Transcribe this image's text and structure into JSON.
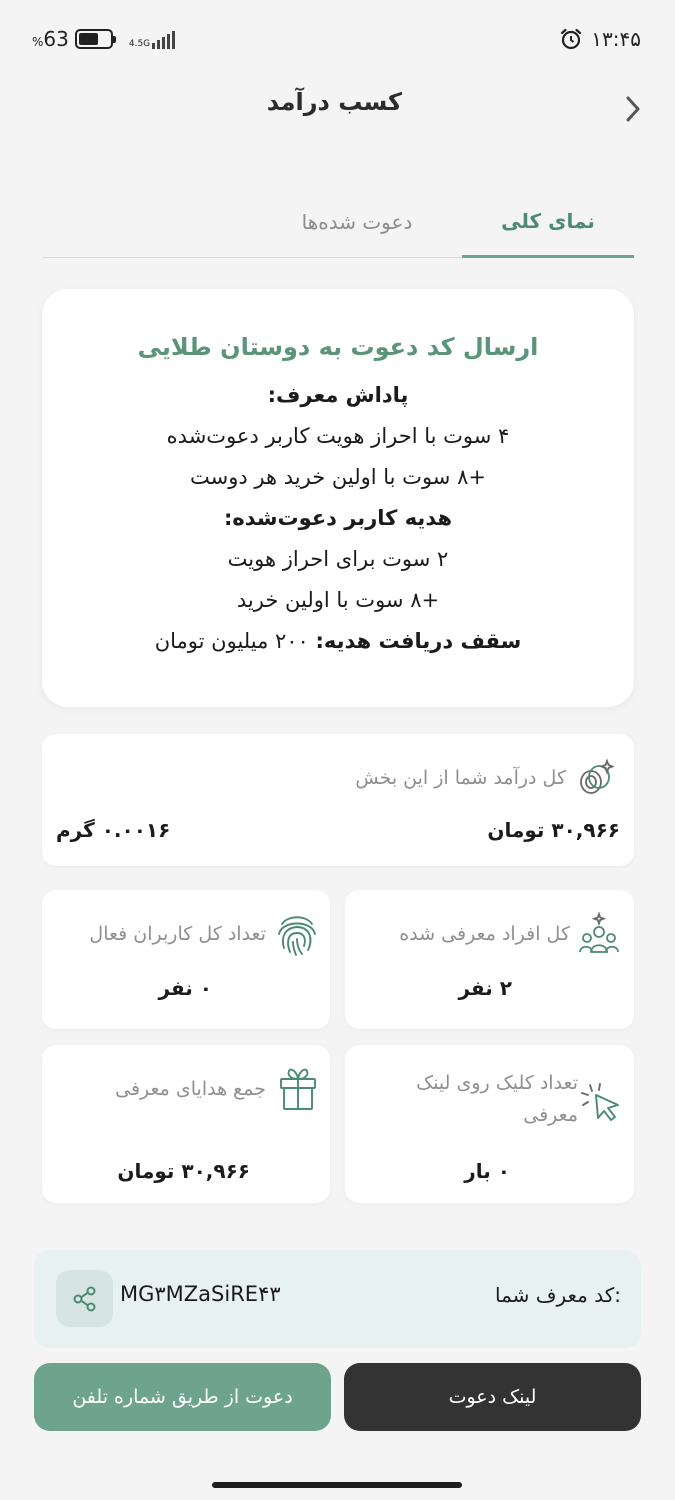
{
  "status_bar": {
    "battery_percent": "63",
    "percent_sign": "%",
    "battery_level": 0.63,
    "network_label": "4.5G",
    "time": "۱۳:۴۵"
  },
  "header": {
    "title": "کسب درآمد"
  },
  "tabs": [
    {
      "label": "نمای کلی",
      "active": true
    },
    {
      "label": "دعوت شده‌ها",
      "active": false
    }
  ],
  "promo": {
    "title": "ارسال کد دعوت به دوستان طلایی",
    "lines": [
      "پاداش معرف:",
      "۴ سوت با احراز هویت کاربر دعوت‌شده",
      "+۸ سوت با اولین خرید هر دوست",
      "هدیه کاربر دعوت‌شده:",
      "۲ سوت برای احراز هویت",
      "+۸ سوت با اولین خرید"
    ],
    "cap_label": "سقف دریافت هدیه:",
    "cap_value": "۲۰۰ میلیون تومان"
  },
  "income": {
    "label": "کل درآمد شما از این بخش",
    "toman_value": "۳۰,۹۶۶ تومان",
    "gram_value": "۰.۰۰۱۶ گرم"
  },
  "stats": {
    "referred_total": {
      "label": "کل افراد معرفی شده",
      "value": "۲ نفر"
    },
    "active_users": {
      "label": "تعداد کل کاربران فعال",
      "value": "۰ نفر"
    },
    "link_clicks": {
      "label": "تعداد کلیک روی لینک معرفی",
      "value": "۰ بار"
    },
    "gifts_total": {
      "label": "جمع هدایای معرفی",
      "value": "۳۰,۹۶۶ تومان"
    }
  },
  "referral": {
    "label": "کد معرف شما:",
    "code": "MG۳MZaSiRE۴۳"
  },
  "buttons": {
    "invite_link": "لینک دعوت",
    "invite_phone": "دعوت از طریق شماره تلفن"
  },
  "colors": {
    "accent": "#6ea48d",
    "accent_text": "#4c8a71",
    "dark_button": "#333333",
    "referral_bg": "#e7f1ef"
  }
}
